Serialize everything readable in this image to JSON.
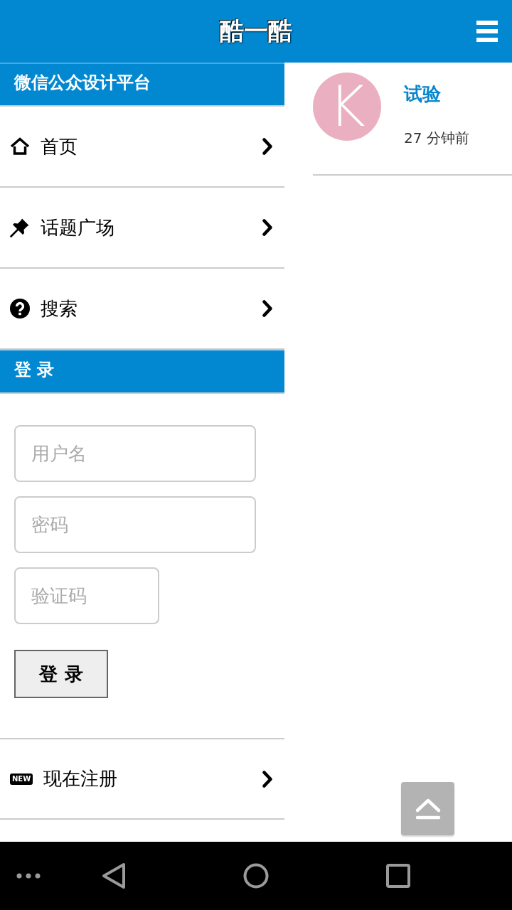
{
  "header": {
    "title": "酷一酷"
  },
  "sidebar": {
    "title": "微信公众设计平台",
    "menu": [
      {
        "label": "首页"
      },
      {
        "label": "话题广场"
      },
      {
        "label": "搜索"
      }
    ],
    "login": {
      "title": "登 录",
      "fields": [
        {
          "placeholder": "用户名"
        },
        {
          "placeholder": "密码"
        },
        {
          "placeholder": "验证码"
        }
      ],
      "button": "登 录"
    },
    "register": {
      "badge": "NEW",
      "label": "现在注册"
    }
  },
  "feed": [
    {
      "avatar_letter": "K",
      "title": "试验",
      "time": "27 分钟前"
    }
  ]
}
